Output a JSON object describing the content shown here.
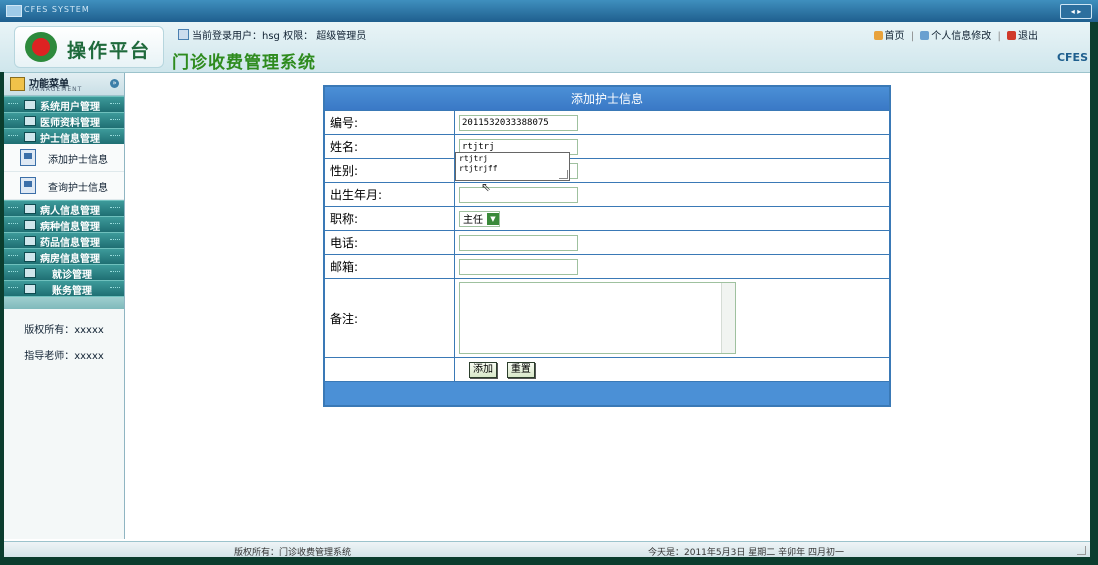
{
  "titlebar": {
    "system": "CFES SYSTEM",
    "controls": "◂ ▸"
  },
  "header": {
    "logo_text": "操作平台",
    "user_label": "当前登录用户：hsg 权限： 超级管理员",
    "system_title": "门诊收费管理系统",
    "links": {
      "home": "首页",
      "profile": "个人信息修改",
      "logout": "退出"
    },
    "brand": "CFES"
  },
  "sidebar": {
    "menu_title": "功能菜单",
    "menu_subtitle": "MANAGEMENT",
    "groups": [
      {
        "label": "系统用户管理"
      },
      {
        "label": "医师资料管理"
      },
      {
        "label": "护士信息管理"
      },
      {
        "label": "病人信息管理"
      },
      {
        "label": "病种信息管理"
      },
      {
        "label": "药品信息管理"
      },
      {
        "label": "病房信息管理"
      },
      {
        "label": "就诊管理"
      },
      {
        "label": "账务管理"
      }
    ],
    "subitems": [
      {
        "label": "添加护士信息"
      },
      {
        "label": "查询护士信息"
      }
    ],
    "copyright": "版权所有：xxxxx",
    "advisor": "指导老师：xxxxx"
  },
  "form": {
    "title": "添加护士信息",
    "fields": {
      "id": {
        "label": "编号:",
        "value": "2011532033388075"
      },
      "name": {
        "label": "姓名:",
        "value": "rtjtrj"
      },
      "gender": {
        "label": "性别:"
      },
      "birth": {
        "label": "出生年月:"
      },
      "title": {
        "label": "职称:",
        "value": "主任"
      },
      "phone": {
        "label": "电话:"
      },
      "email": {
        "label": "邮箱:"
      },
      "note": {
        "label": "备注:"
      }
    },
    "autocomplete": [
      "rtjtrj",
      "rtjtrjff"
    ],
    "buttons": {
      "add": "添加",
      "reset": "重置"
    }
  },
  "status": {
    "copyright": "版权所有：门诊收费管理系统",
    "date": "今天是：2011年5月3日 星期二 辛卯年 四月初一"
  }
}
